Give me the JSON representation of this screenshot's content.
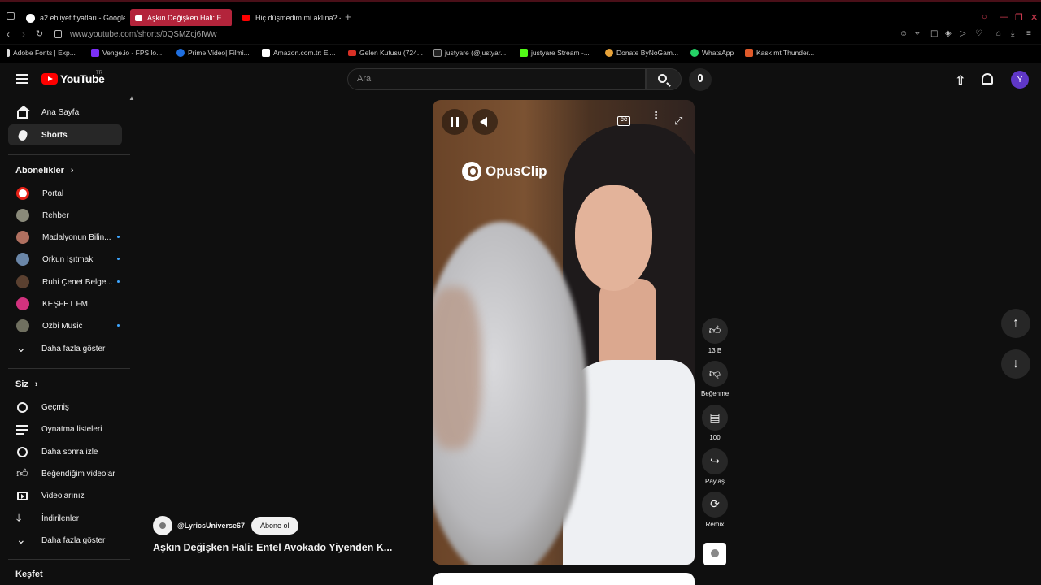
{
  "browser": {
    "tabs": [
      {
        "label": "a2 ehliyet fiyatları - Google",
        "active": false
      },
      {
        "label": "Aşkın Değişken Hali: E",
        "active": true
      },
      {
        "label": "Hiç düşmedim mi aklına? -",
        "active": false
      }
    ],
    "new_tab": "+",
    "url": "www.youtube.com/shorts/0QSMZcj6IWw",
    "bookmarks": [
      "Adobe Fonts | Exp...",
      "Venge.io - FPS lo...",
      "Prime Video| Filmi...",
      "Amazon.com.tr: El...",
      "Gelen Kutusu (724...",
      "justyare (@justyar...",
      "justyare Stream -...",
      "Donate ByNoGam...",
      "WhatsApp",
      "Kask mt Thunder..."
    ]
  },
  "header": {
    "logo_text": "YouTube",
    "logo_region": "TR",
    "search_placeholder": "Ara",
    "avatar_letter": "Y"
  },
  "sidebar": {
    "main": [
      {
        "label": "Ana Sayfa",
        "icon": "home-icon"
      },
      {
        "label": "Shorts",
        "icon": "shorts-icon",
        "active": true
      }
    ],
    "subscriptions_title": "Abonelikler",
    "subscriptions": [
      {
        "label": "Portal",
        "color": "#e62117",
        "dot": false
      },
      {
        "label": "Rehber",
        "color": "#8a8a7a",
        "dot": false
      },
      {
        "label": "Madalyonun Bilin...",
        "color": "#b07060",
        "dot": true
      },
      {
        "label": "Orkun Işıtmak",
        "color": "#6a86a8",
        "dot": true
      },
      {
        "label": "Ruhi Çenet Belge...",
        "color": "#5a4030",
        "dot": true
      },
      {
        "label": "KEŞFET FM",
        "color": "#d2327e",
        "dot": false
      },
      {
        "label": "Ozbi Music",
        "color": "#707060",
        "dot": true
      }
    ],
    "show_more": "Daha fazla göster",
    "you_title": "Siz",
    "you_items": [
      {
        "label": "Geçmiş",
        "icon": "history-icon"
      },
      {
        "label": "Oynatma listeleri",
        "icon": "playlists-icon"
      },
      {
        "label": "Daha sonra izle",
        "icon": "watch-later-icon"
      },
      {
        "label": "Beğendiğim videolar",
        "icon": "liked-videos-icon"
      },
      {
        "label": "Videolarınız",
        "icon": "your-videos-icon"
      },
      {
        "label": "İndirilenler",
        "icon": "downloads-icon"
      }
    ],
    "show_more_2": "Daha fazla göster",
    "explore_title": "Keşfet"
  },
  "player": {
    "watermark": "OpusClip"
  },
  "actions": {
    "like_count": "13 B",
    "dislike_label": "Beğenme",
    "comment_count": "100",
    "share_label": "Paylaş",
    "remix_label": "Remix"
  },
  "video": {
    "channel": "@LyricsUniverse67",
    "subscribe_label": "Abone ol",
    "title": "Aşkın Değişken Hali: Entel Avokado Yiyenden K..."
  }
}
